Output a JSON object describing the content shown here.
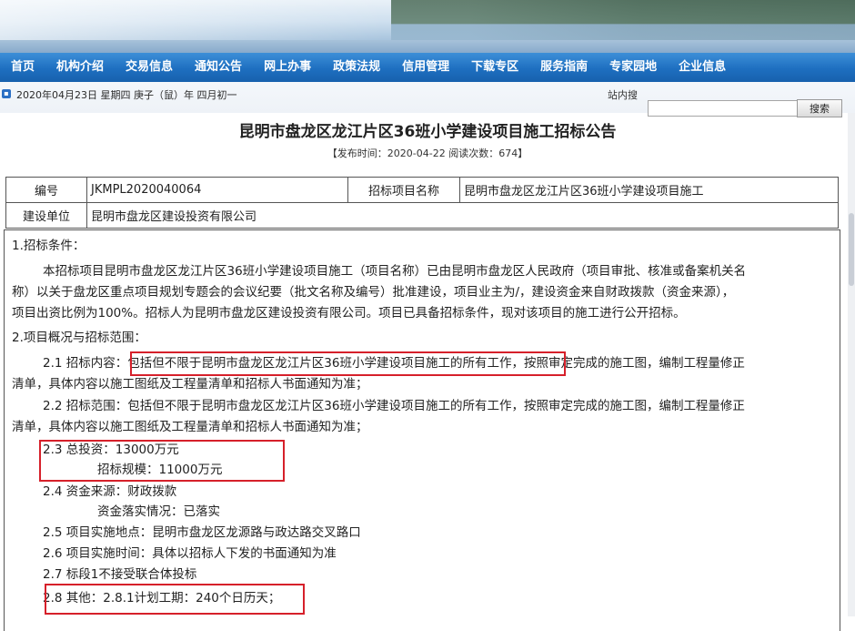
{
  "nav": {
    "items": [
      "首页",
      "机构介绍",
      "交易信息",
      "通知公告",
      "网上办事",
      "政策法规",
      "信用管理",
      "下载专区",
      "服务指南",
      "专家园地",
      "企业信息"
    ]
  },
  "datebar": {
    "date_text": "2020年04月23日  星期四  庚子（鼠）年  四月初一",
    "site_search_label": "站内搜",
    "search_value": "",
    "search_button": "搜索"
  },
  "article": {
    "title": "昆明市盘龙区龙江片区36班小学建设项目施工招标公告",
    "meta": "【发布时间：2020-04-22  阅读次数：674】"
  },
  "info": {
    "code_label": "编号",
    "code_value": "JKMPL2020040064",
    "project_label": "招标项目名称",
    "project_value": "昆明市盘龙区龙江片区36班小学建设项目施工",
    "unit_label": "建设单位",
    "unit_value": "昆明市盘龙区建设投资有限公司"
  },
  "content": {
    "s1_heading": "1.招标条件：",
    "s1_line1": "本招标项目昆明市盘龙区龙江片区36班小学建设项目施工（项目名称）已由昆明市盘龙区人民政府（项目审批、核准或备案机关名",
    "s1_line2": "称）以关于盘龙区重点项目规划专题会的会议纪要（批文名称及编号）批准建设，项目业主为/，建设资金来自财政拨款（资金来源），",
    "s1_line3": "项目出资比例为100%。招标人为昆明市盘龙区建设投资有限公司。项目已具备招标条件，现对该项目的施工进行公开招标。",
    "s2_heading": "2.项目概况与招标范围：",
    "s21_line1": "2.1 招标内容：包括但不限于昆明市盘龙区龙江片区36班小学建设项目施工的所有工作，按照审定完成的施工图，编制工程量修正",
    "s21_line2": "清单，具体内容以施工图纸及工程量清单和招标人书面通知为准；",
    "s22_line1": "2.2 招标范围：包括但不限于昆明市盘龙区龙江片区36班小学建设项目施工的所有工作，按照审定完成的施工图，编制工程量修正",
    "s22_line2": "清单，具体内容以施工图纸及工程量清单和招标人书面通知为准；",
    "s23_line1": "2.3 总投资：13000万元",
    "s23_line2": "招标规模：11000万元",
    "s24_line1": "2.4 资金来源：财政拨款",
    "s24_line2": "资金落实情况：已落实",
    "s25": "2.5 项目实施地点：昆明市盘龙区龙源路与政达路交叉路口",
    "s26": "2.6 项目实施时间：具体以招标人下发的书面通知为准",
    "s27": "2.7 标段1不接受联合体投标",
    "s28": "2.8 其他：2.8.1计划工期：240个日历天；"
  },
  "highlight_color": "#d6202a",
  "nav_color": "#1e6fc0"
}
